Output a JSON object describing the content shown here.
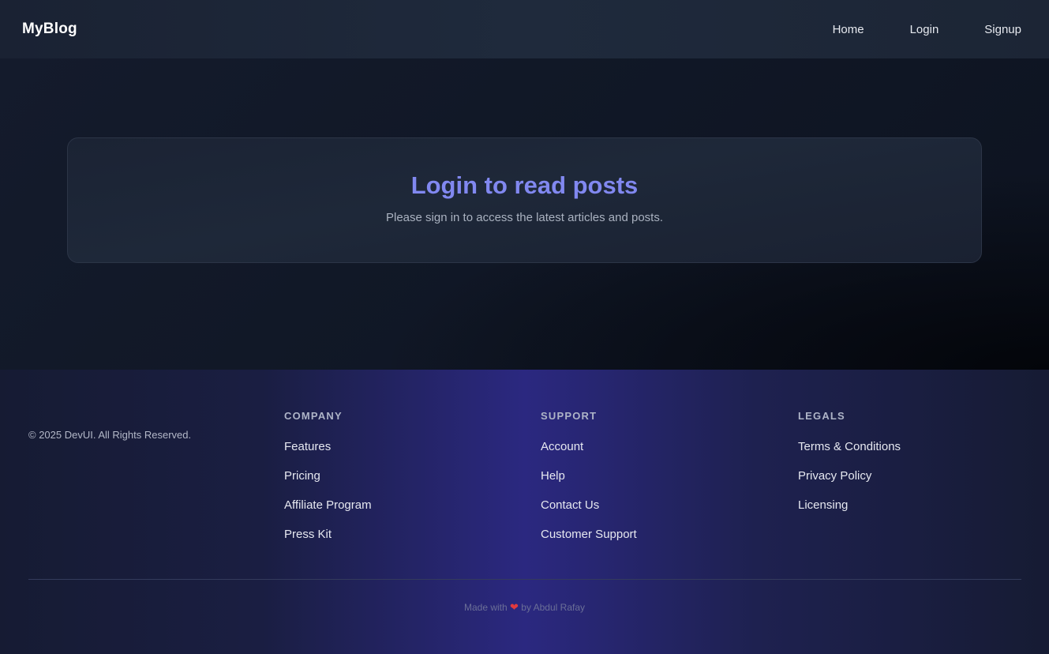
{
  "navbar": {
    "brand": "MyBlog",
    "links": [
      "Home",
      "Login",
      "Signup"
    ]
  },
  "card": {
    "title": "Login to read posts",
    "subtitle": "Please sign in to access the latest articles and posts."
  },
  "footer": {
    "copyright": "© 2025 DevUI. All Rights Reserved.",
    "columns": [
      {
        "heading": "COMPANY",
        "links": [
          "Features",
          "Pricing",
          "Affiliate Program",
          "Press Kit"
        ]
      },
      {
        "heading": "SUPPORT",
        "links": [
          "Account",
          "Help",
          "Contact Us",
          "Customer Support"
        ]
      },
      {
        "heading": "LEGALS",
        "links": [
          "Terms & Conditions",
          "Privacy Policy",
          "Licensing"
        ]
      }
    ],
    "made_with_prefix": "Made with",
    "made_with_icon": "heart-icon",
    "made_with_suffix": "by Abdul Rafay"
  },
  "colors": {
    "accent": "#8188f0",
    "heart": "#e03a3e"
  }
}
